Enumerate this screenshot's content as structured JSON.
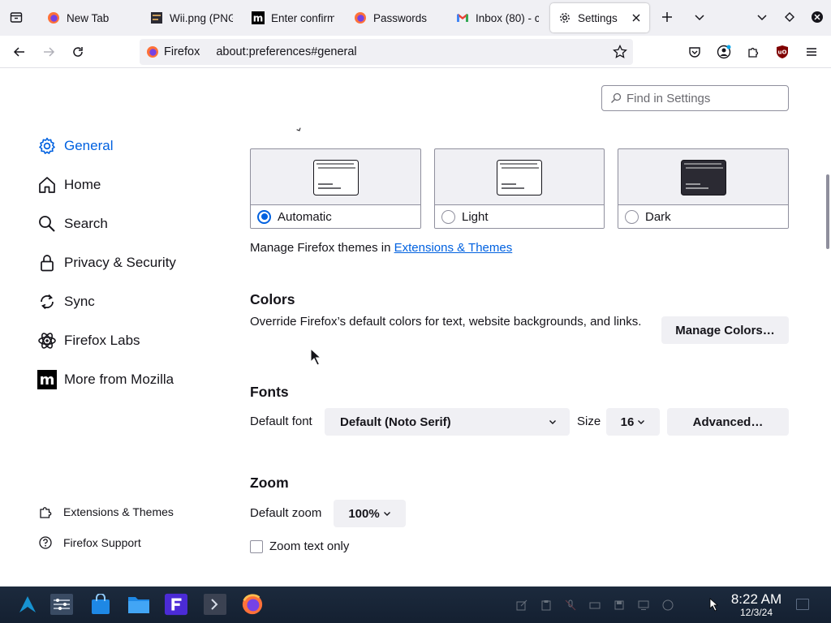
{
  "browser": {
    "tabs": [
      {
        "title": "New Tab",
        "icon": "firefox-icon",
        "active": false
      },
      {
        "title": "Wii.png (PNG",
        "icon": "image-icon",
        "active": false
      },
      {
        "title": "Enter confirm",
        "icon": "mozilla-m-icon",
        "active": false
      },
      {
        "title": "Passwords",
        "icon": "firefox-icon",
        "active": false
      },
      {
        "title": "Inbox (80) - c",
        "icon": "gmail-icon",
        "active": false
      },
      {
        "title": "Settings",
        "icon": "gear-icon",
        "active": true
      }
    ],
    "url_identity": "Firefox",
    "url": "about:preferences#general"
  },
  "settings": {
    "search_placeholder": "Find in Settings",
    "sidebar": [
      {
        "label": "General",
        "icon": "gear-icon",
        "selected": true
      },
      {
        "label": "Home",
        "icon": "home-icon",
        "selected": false
      },
      {
        "label": "Search",
        "icon": "search-icon",
        "selected": false
      },
      {
        "label": "Privacy & Security",
        "icon": "lock-icon",
        "selected": false
      },
      {
        "label": "Sync",
        "icon": "sync-icon",
        "selected": false
      },
      {
        "label": "Firefox Labs",
        "icon": "labs-icon",
        "selected": false
      },
      {
        "label": "More from Mozilla",
        "icon": "mozilla-icon",
        "selected": false
      }
    ],
    "footer": [
      {
        "label": "Extensions & Themes",
        "icon": "puzzle-icon"
      },
      {
        "label": "Firefox Support",
        "icon": "help-icon"
      }
    ],
    "themes": [
      {
        "label": "Automatic",
        "selected": true
      },
      {
        "label": "Light",
        "selected": false
      },
      {
        "label": "Dark",
        "selected": false
      }
    ],
    "themes_text": "Manage Firefox themes in",
    "themes_link": "Extensions & Themes",
    "colors": {
      "heading": "Colors",
      "description": "Override Firefox’s default colors for text, website backgrounds, and links.",
      "button": "Manage Colors…"
    },
    "fonts": {
      "heading": "Fonts",
      "default_font_label": "Default font",
      "default_font_value": "Default (Noto Serif)",
      "size_label": "Size",
      "size_value": "16",
      "advanced_button": "Advanced…"
    },
    "zoom": {
      "heading": "Zoom",
      "default_zoom_label": "Default zoom",
      "default_zoom_value": "100%",
      "text_only_label": "Zoom text only",
      "text_only_checked": false
    }
  },
  "taskbar": {
    "time": "8:22 AM",
    "date": "12/3/24"
  },
  "colors": {
    "accent": "#0061e0",
    "taskbar_bg": "#1c2a3d",
    "tab_strip_bg": "#f0f0f4"
  }
}
